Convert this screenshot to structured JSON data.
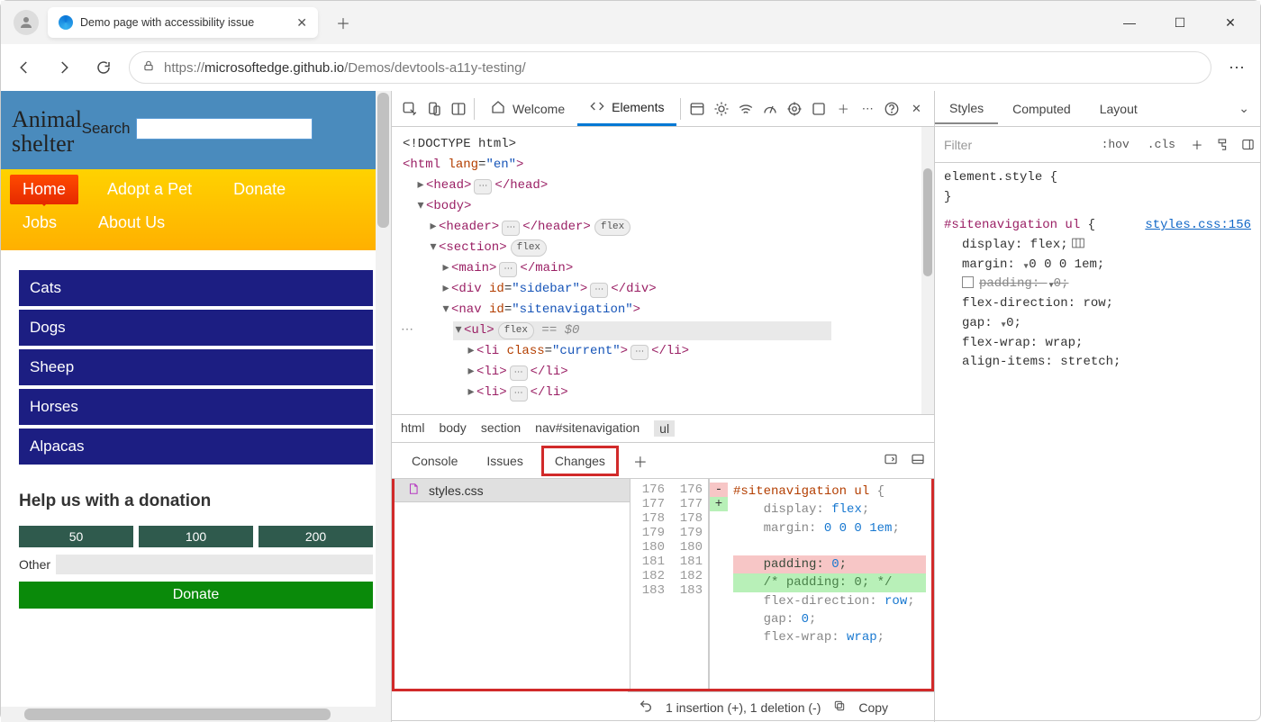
{
  "browser": {
    "tab_title": "Demo page with accessibility issue",
    "url_host": "microsoftedge.github.io",
    "url_protocol": "https://",
    "url_path": "/Demos/devtools-a11y-testing/"
  },
  "page": {
    "brand_line1": "Animal",
    "brand_line2": "shelter",
    "search_label": "Search",
    "nav": [
      "Home",
      "Adopt a Pet",
      "Donate",
      "Jobs",
      "About Us"
    ],
    "categories": [
      "Cats",
      "Dogs",
      "Sheep",
      "Horses",
      "Alpacas"
    ],
    "donate_heading": "Help us with a donation",
    "amounts": [
      "50",
      "100",
      "200"
    ],
    "other_label": "Other",
    "donate_button": "Donate"
  },
  "devtools": {
    "top_tabs": {
      "welcome": "Welcome",
      "elements": "Elements"
    },
    "dom": {
      "l1": "<!DOCTYPE html>",
      "html_open": "<html ",
      "html_attr": "lang",
      "html_val": "\"en\"",
      "html_close": ">",
      "head_o": "<head>",
      "head_c": "</head>",
      "body_o": "<body>",
      "header_o": "<header>",
      "header_c": "</header>",
      "header_pill": "flex",
      "section_o": "<section>",
      "section_pill": "flex",
      "main_o": "<main>",
      "main_c": "</main>",
      "div_o": "<div ",
      "div_attr": "id",
      "div_val": "\"sidebar\"",
      "div_m": ">",
      "div_c": "</div>",
      "nav_o": "<nav ",
      "nav_attr": "id",
      "nav_val": "\"sitenavigation\"",
      "nav_c": ">",
      "ul_o": "<ul>",
      "ul_pill": "flex",
      "ul_sel": "== $0",
      "li1_o": "<li ",
      "li1_attr": "class",
      "li1_val": "\"current\"",
      "li1_m": ">",
      "li1_c": "</li>",
      "li_o": "<li>",
      "li_c": "</li>"
    },
    "breadcrumb": [
      "html",
      "body",
      "section",
      "nav#sitenavigation",
      "ul"
    ],
    "drawer_tabs": {
      "console": "Console",
      "issues": "Issues",
      "changes": "Changes"
    },
    "changes": {
      "file": "styles.css",
      "gutter_old": [
        "176",
        "177",
        "178",
        "179",
        "180",
        "",
        "181",
        "182",
        "183"
      ],
      "gutter_new": [
        "176",
        "177",
        "178",
        "179",
        "",
        "180",
        "181",
        "182",
        "183"
      ],
      "marks": [
        "",
        "",
        "",
        "",
        "-",
        "+",
        "",
        "",
        ""
      ],
      "lines": {
        "l0_sel": "#sitenavigation ul ",
        "l0_brace": "{",
        "l1_p": "display: ",
        "l1_v": "flex",
        "l1_t": ";",
        "l2_p": "margin: ",
        "l2_v": "0 0 0 1em",
        "l2_t": ";",
        "l3_p": "padding: ",
        "l3_v": "0",
        "l3_t": ";",
        "l4_c": "/* padding: 0; */",
        "l5_p": "flex-direction: ",
        "l5_v": "row",
        "l5_t": ";",
        "l6_p": "gap: ",
        "l6_v": "0",
        "l6_t": ";",
        "l7_p": "flex-wrap: ",
        "l7_v": "wrap",
        "l7_t": ";"
      },
      "status": "1 insertion (+), 1 deletion (-)",
      "copy": "Copy"
    },
    "styles": {
      "tabs": {
        "styles": "Styles",
        "computed": "Computed",
        "layout": "Layout"
      },
      "filter": "Filter",
      "hov": ":hov",
      "cls": ".cls",
      "element_style": "element.style {",
      "close_brace": "}",
      "rule_sel": "#sitenavigation ul",
      "rule_open": "{",
      "rule_link": "styles.css:156",
      "p_display": "display",
      "v_display": "flex",
      "p_margin": "margin",
      "v_margin": "0 0 0 1em",
      "p_padding": "padding",
      "v_padding": "0",
      "p_flexdir": "flex-direction",
      "v_flexdir": "row",
      "p_gap": "gap",
      "v_gap": "0",
      "p_flexwrap": "flex-wrap",
      "v_flexwrap": "wrap",
      "p_align": "align-items",
      "v_align": "stretch"
    }
  }
}
